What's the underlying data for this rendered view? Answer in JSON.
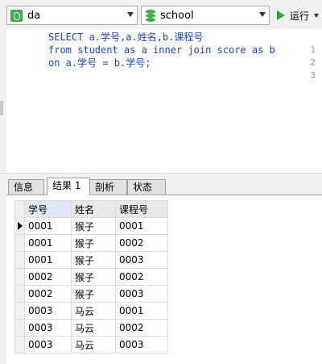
{
  "toolbar": {
    "connection": "da",
    "database": "school",
    "run_label": "运行"
  },
  "editor": {
    "lines": [
      {
        "num": "1",
        "text": "SELECT a.学号,a.姓名,b.课程号"
      },
      {
        "num": "2",
        "text": "from student as a inner join score as b"
      },
      {
        "num": "3",
        "text": "on a.学号 = b.学号;"
      }
    ]
  },
  "tabs": [
    {
      "label": "信息"
    },
    {
      "label": "结果 1"
    },
    {
      "label": "剖析"
    },
    {
      "label": "状态"
    }
  ],
  "grid": {
    "columns": [
      "学号",
      "姓名",
      "课程号"
    ],
    "rows": [
      [
        "0001",
        "猴子",
        "0001"
      ],
      [
        "0001",
        "猴子",
        "0002"
      ],
      [
        "0001",
        "猴子",
        "0003"
      ],
      [
        "0002",
        "猴子",
        "0002"
      ],
      [
        "0002",
        "猴子",
        "0003"
      ],
      [
        "0003",
        "马云",
        "0001"
      ],
      [
        "0003",
        "马云",
        "0002"
      ],
      [
        "0003",
        "马云",
        "0003"
      ]
    ]
  },
  "colors": {
    "keyword": "#1f44c9",
    "run_green": "#2ea43a",
    "header_highlight": "#dbe9f6"
  }
}
